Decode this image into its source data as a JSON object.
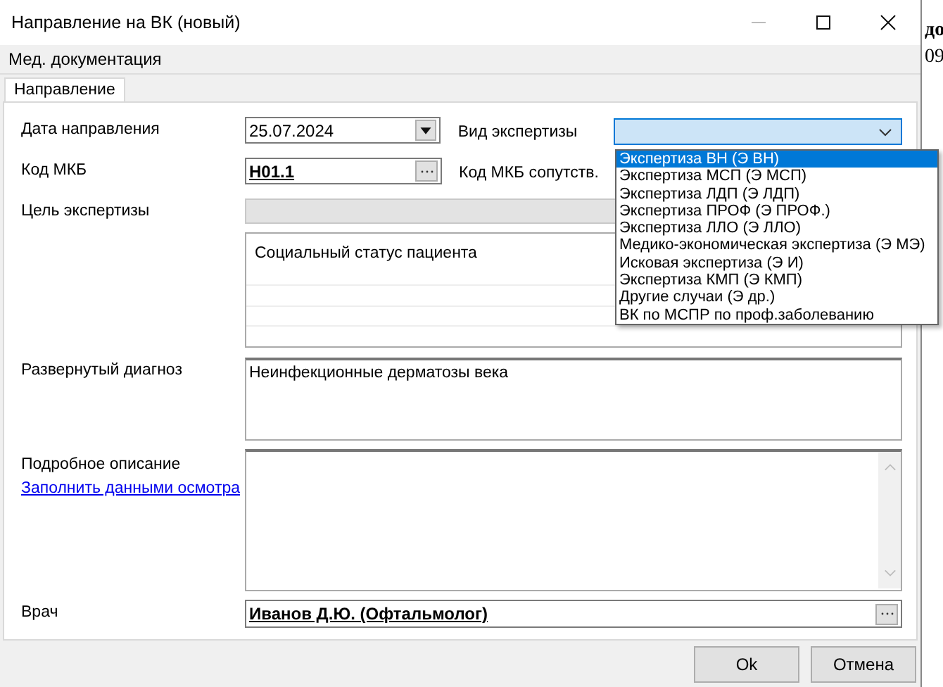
{
  "window": {
    "title": "Направление на ВК (новый)"
  },
  "menu": [
    "Мед. документация"
  ],
  "tabs": [
    {
      "label": "Направление",
      "selected": true
    }
  ],
  "form": {
    "date": {
      "label": "Дата направления",
      "value": "25.07.2024"
    },
    "expertise": {
      "label": "Вид экспертизы",
      "expanded": true,
      "options": [
        {
          "label": "Экспертиза ВН (Э ВН)",
          "selected": true
        },
        {
          "label": "Экспертиза МСП (Э МСП)",
          "selected": false
        },
        {
          "label": "Экспертиза ЛДП (Э ЛДП)",
          "selected": false
        },
        {
          "label": "Экспертиза ПРОФ (Э ПРОФ.)",
          "selected": false
        },
        {
          "label": "Экспертиза ЛЛО (Э ЛЛО)",
          "selected": false
        },
        {
          "label": "Медико-экономическая экспертиза (Э МЭ)",
          "selected": false
        },
        {
          "label": "Исковая экспертиза (Э И)",
          "selected": false
        },
        {
          "label": "Экспертиза КМП (Э КМП)",
          "selected": false
        },
        {
          "label": "Другие случаи (Э др.)",
          "selected": false
        },
        {
          "label": "ВК по МСПР по проф.заболеванию",
          "selected": false
        }
      ]
    },
    "icd": {
      "label": "Код МКБ",
      "value": "H01.1"
    },
    "icd_secondary": {
      "label": "Код МКБ сопутств."
    },
    "purpose": {
      "label": "Цель экспертизы",
      "disabled": true
    },
    "social_status": {
      "items": [
        "Социальный статус пациента"
      ]
    },
    "diagnosis": {
      "label": "Развернутый диагноз",
      "value": "Неинфекционные дерматозы века"
    },
    "description": {
      "label": "Подробное описание",
      "link": "Заполнить данными осмотра"
    },
    "doctor": {
      "label": "Врач",
      "value": "Иванов Д.Ю. (Офтальмолог)"
    }
  },
  "buttons": [
    "Ok",
    "Отмена"
  ],
  "background_window": {
    "texts": [
      "до",
      "09"
    ]
  }
}
